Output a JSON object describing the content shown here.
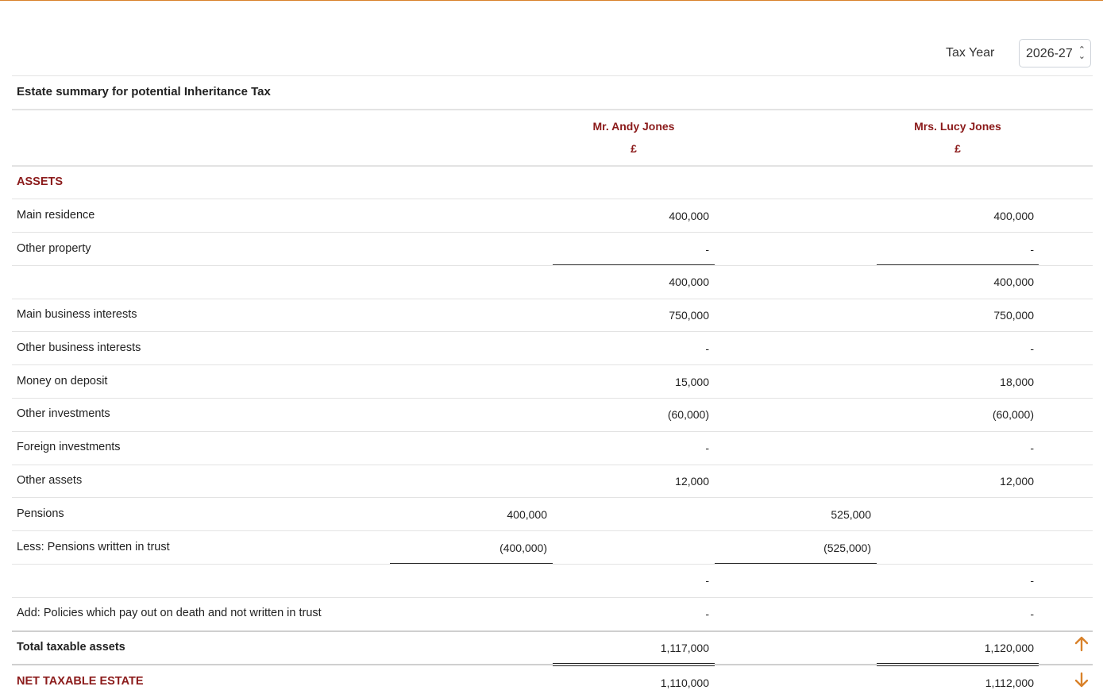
{
  "tax_year": {
    "label": "Tax Year",
    "value": "2026-27"
  },
  "title": "Estate summary for potential Inheritance Tax",
  "columns": [
    {
      "name": "Mr. Andy Jones",
      "currency": "£"
    },
    {
      "name": "Mrs. Lucy Jones",
      "currency": "£"
    }
  ],
  "section": "ASSETS",
  "rows": {
    "main_residence": {
      "label": "Main residence",
      "a": "400,000",
      "b": "400,000"
    },
    "other_property": {
      "label": "Other property",
      "a": "-",
      "b": "-"
    },
    "property_subtotal": {
      "a": "400,000",
      "b": "400,000"
    },
    "main_business": {
      "label": "Main business interests",
      "a": "750,000",
      "b": "750,000"
    },
    "other_business": {
      "label": "Other business interests",
      "a": "-",
      "b": "-"
    },
    "money_deposit": {
      "label": "Money on deposit",
      "a": "15,000",
      "b": "18,000"
    },
    "other_investments": {
      "label": "Other investments",
      "a": "(60,000)",
      "b": "(60,000)"
    },
    "foreign_investments": {
      "label": "Foreign investments",
      "a": "-",
      "b": "-"
    },
    "other_assets": {
      "label": "Other assets",
      "a": "12,000",
      "b": "12,000"
    },
    "pensions": {
      "label": "Pensions",
      "a": "400,000",
      "b": "525,000"
    },
    "pensions_trust": {
      "label": "Less: Pensions written in trust",
      "a": "(400,000)",
      "b": "(525,000)"
    },
    "pensions_net": {
      "a": "-",
      "b": "-"
    },
    "policies": {
      "label": "Add: Policies which pay out on death and not written in trust",
      "a": "-",
      "b": "-"
    },
    "total_taxable": {
      "label": "Total taxable assets",
      "a": "1,117,000",
      "b": "1,120,000"
    },
    "net_estate": {
      "label": "NET TAXABLE ESTATE",
      "a": "1,110,000",
      "b": "1,112,000"
    }
  },
  "icons": {
    "scroll_up": "arrow-up-icon",
    "scroll_down": "arrow-down-icon",
    "accent": "#d9822b",
    "brand_red": "#8b1a1a"
  }
}
